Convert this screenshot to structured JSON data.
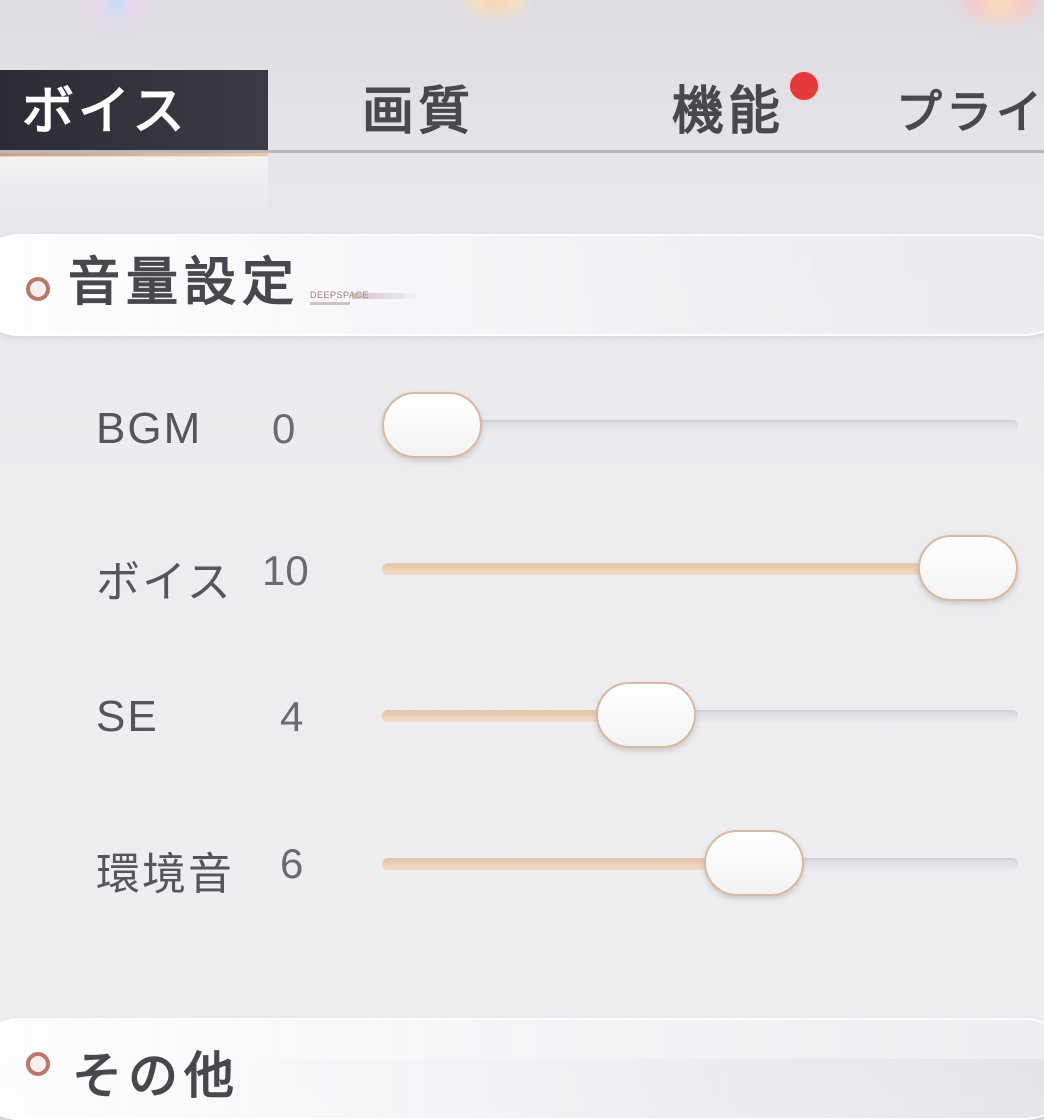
{
  "tabs": [
    {
      "label": "ボイス",
      "active": true
    },
    {
      "label": "画質",
      "active": false
    },
    {
      "label": "機能",
      "active": false,
      "badge": true
    },
    {
      "label": "プライバシー",
      "active": false
    }
  ],
  "section": {
    "title": "音量設定",
    "brand": "DEEPSPACE"
  },
  "sliders": [
    {
      "label": "BGM",
      "value": "0",
      "fraction": 0.0
    },
    {
      "label": "ボイス",
      "value": "10",
      "fraction": 1.0
    },
    {
      "label": "SE",
      "value": "4",
      "fraction": 0.4
    },
    {
      "label": "環境音",
      "value": "6",
      "fraction": 0.6
    }
  ],
  "next_section": {
    "title": "その他"
  },
  "colors": {
    "accent": "#e4c6a8",
    "badge": "#e23a3d",
    "active_tab_bg": "#2c2c34"
  }
}
